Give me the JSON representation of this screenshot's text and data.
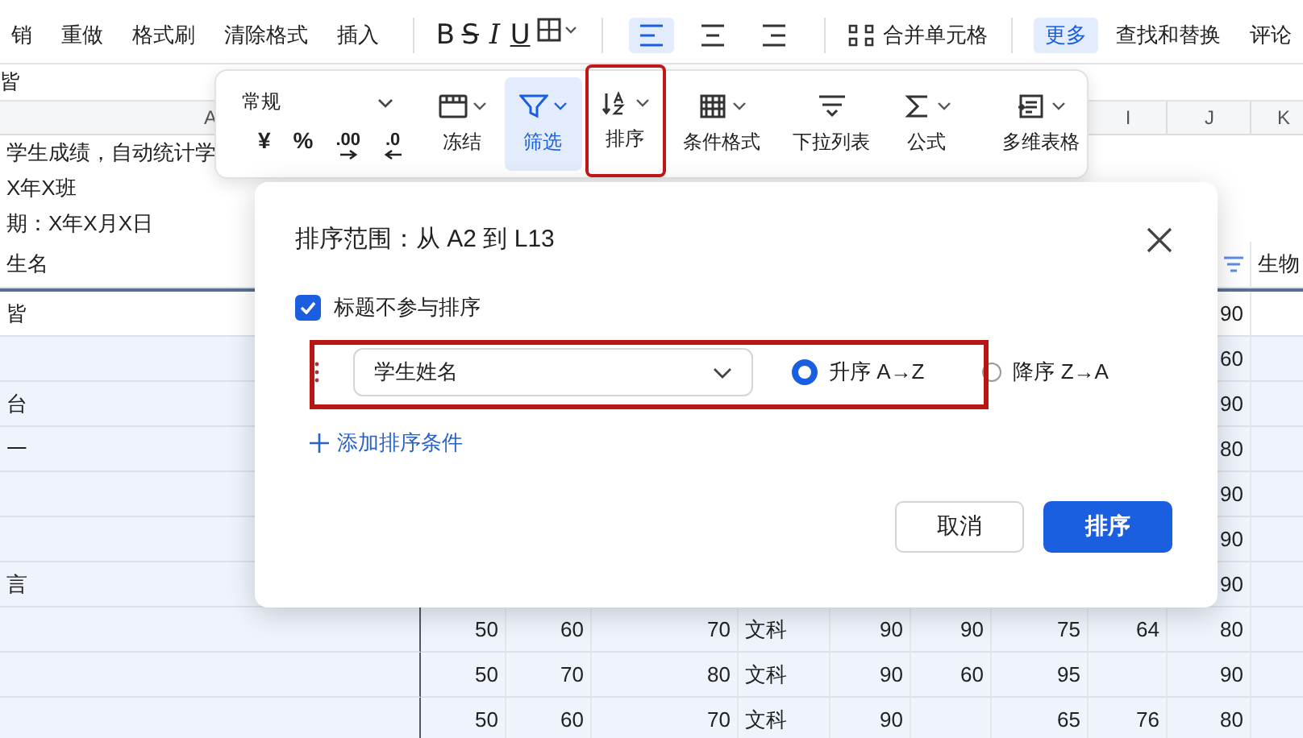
{
  "toolbar": {
    "left_items": [
      {
        "label": "销"
      },
      {
        "label": "重做"
      },
      {
        "label": "格式刷"
      },
      {
        "label": "清除格式"
      },
      {
        "label": "插入"
      }
    ],
    "format_buttons": [
      {
        "glyph": "B",
        "kind": "bold"
      },
      {
        "glyph": "S",
        "kind": "strike"
      },
      {
        "glyph": "I",
        "kind": "italic"
      },
      {
        "glyph": "U",
        "kind": "underline"
      },
      {
        "kind": "border"
      }
    ],
    "align_buttons": [
      {
        "kind": "left",
        "selected": true
      },
      {
        "kind": "center",
        "selected": false
      },
      {
        "kind": "right",
        "selected": false
      }
    ],
    "merge": {
      "label": "合并单元格"
    },
    "right_items": [
      {
        "label": "更多",
        "selected": true
      },
      {
        "label": "查找和替换",
        "selected": false
      },
      {
        "label": "评论",
        "selected": false
      }
    ]
  },
  "formula_bar": {
    "value": "皆"
  },
  "sheet": {
    "column_headers": [
      "A",
      "I",
      "J",
      "K"
    ],
    "rows": [
      {
        "kind": "text",
        "selected": false,
        "cells": [
          "学生成绩，自动统计学",
          null,
          null,
          null,
          null,
          null,
          null,
          null,
          null,
          null,
          null
        ]
      },
      {
        "kind": "text",
        "selected": false,
        "cells": [
          "X年X班",
          null,
          null,
          null,
          null,
          null,
          null,
          null,
          null,
          null,
          null
        ]
      },
      {
        "kind": "text",
        "selected": false,
        "cells": [
          "期：X年X月X日",
          null,
          null,
          null,
          null,
          null,
          null,
          null,
          null,
          null,
          null
        ]
      },
      {
        "kind": "header",
        "selected": false,
        "filtered": true,
        "cells": [
          "生名",
          null,
          null,
          null,
          null,
          null,
          null,
          null,
          null,
          null,
          "生物"
        ]
      },
      {
        "kind": "data",
        "selected": false,
        "cells": [
          "皆",
          null,
          null,
          null,
          null,
          null,
          null,
          null,
          null,
          "90",
          null
        ]
      },
      {
        "kind": "data",
        "selected": true,
        "cells": [
          null,
          null,
          null,
          null,
          null,
          null,
          null,
          null,
          null,
          "60",
          null
        ]
      },
      {
        "kind": "data",
        "selected": true,
        "cells": [
          "台",
          null,
          null,
          null,
          null,
          null,
          null,
          null,
          null,
          "90",
          null
        ]
      },
      {
        "kind": "data",
        "selected": true,
        "cells": [
          "一",
          null,
          null,
          null,
          null,
          null,
          null,
          null,
          null,
          "80",
          null
        ]
      },
      {
        "kind": "data",
        "selected": true,
        "cells": [
          null,
          null,
          null,
          null,
          null,
          null,
          null,
          null,
          null,
          "90",
          null
        ]
      },
      {
        "kind": "data",
        "selected": true,
        "cells": [
          null,
          null,
          null,
          null,
          null,
          null,
          null,
          null,
          null,
          "90",
          null
        ]
      },
      {
        "kind": "data",
        "selected": true,
        "cells": [
          "言",
          null,
          null,
          null,
          null,
          null,
          null,
          null,
          null,
          "90",
          null
        ]
      },
      {
        "kind": "data",
        "selected": true,
        "cells": [
          null,
          "50",
          "60",
          "70",
          "文科",
          "90",
          "90",
          "75",
          "64",
          "80",
          null
        ]
      },
      {
        "kind": "data",
        "selected": true,
        "cells": [
          null,
          "50",
          "70",
          "80",
          "文科",
          "90",
          "60",
          "95",
          null,
          "90",
          null
        ]
      },
      {
        "kind": "data",
        "selected": true,
        "cells": [
          null,
          "50",
          "60",
          "70",
          "文科",
          "90",
          null,
          "65",
          "76",
          "80",
          null
        ]
      }
    ]
  },
  "popover": {
    "number_format": {
      "value": "常规"
    },
    "number_buttons": [
      {
        "glyph": "¥",
        "kind": "currency"
      },
      {
        "glyph": "%",
        "kind": "percent"
      },
      {
        "glyph": ".00",
        "kind": "more_decimals"
      },
      {
        "glyph": ".0",
        "kind": "fewer_decimals"
      }
    ],
    "tool_groups": [
      [
        {
          "label": "冻结",
          "kind": "freeze",
          "selected": false,
          "highlighted": false,
          "dropdown": true
        },
        {
          "label": "筛选",
          "kind": "filter",
          "selected": true,
          "highlighted": false,
          "dropdown": true
        },
        {
          "label": "排序",
          "kind": "sort",
          "selected": false,
          "highlighted": true,
          "dropdown": true
        },
        {
          "label": "条件格式",
          "kind": "conditional",
          "selected": false,
          "highlighted": false,
          "dropdown": true
        },
        {
          "label": "下拉列表",
          "kind": "dropdown_list",
          "selected": false,
          "highlighted": false,
          "dropdown": false
        },
        {
          "label": "公式",
          "kind": "sum",
          "selected": false,
          "highlighted": false,
          "dropdown": true
        }
      ],
      [
        {
          "label": "多维表格",
          "kind": "table",
          "selected": false,
          "highlighted": false,
          "dropdown": true
        }
      ]
    ]
  },
  "dialog": {
    "title": "排序范围：从 A2 到 L13",
    "skip_header": {
      "label": "标题不参与排序",
      "checked": true
    },
    "condition": {
      "column": "学生姓名",
      "highlighted": true,
      "orders": [
        {
          "label": "升序 A→Z",
          "selected": true
        },
        {
          "label": "降序 Z→A",
          "selected": false
        }
      ]
    },
    "add_link": "添加排序条件",
    "buttons": [
      {
        "label": "取消",
        "kind": "secondary"
      },
      {
        "label": "排序",
        "kind": "primary"
      }
    ]
  }
}
